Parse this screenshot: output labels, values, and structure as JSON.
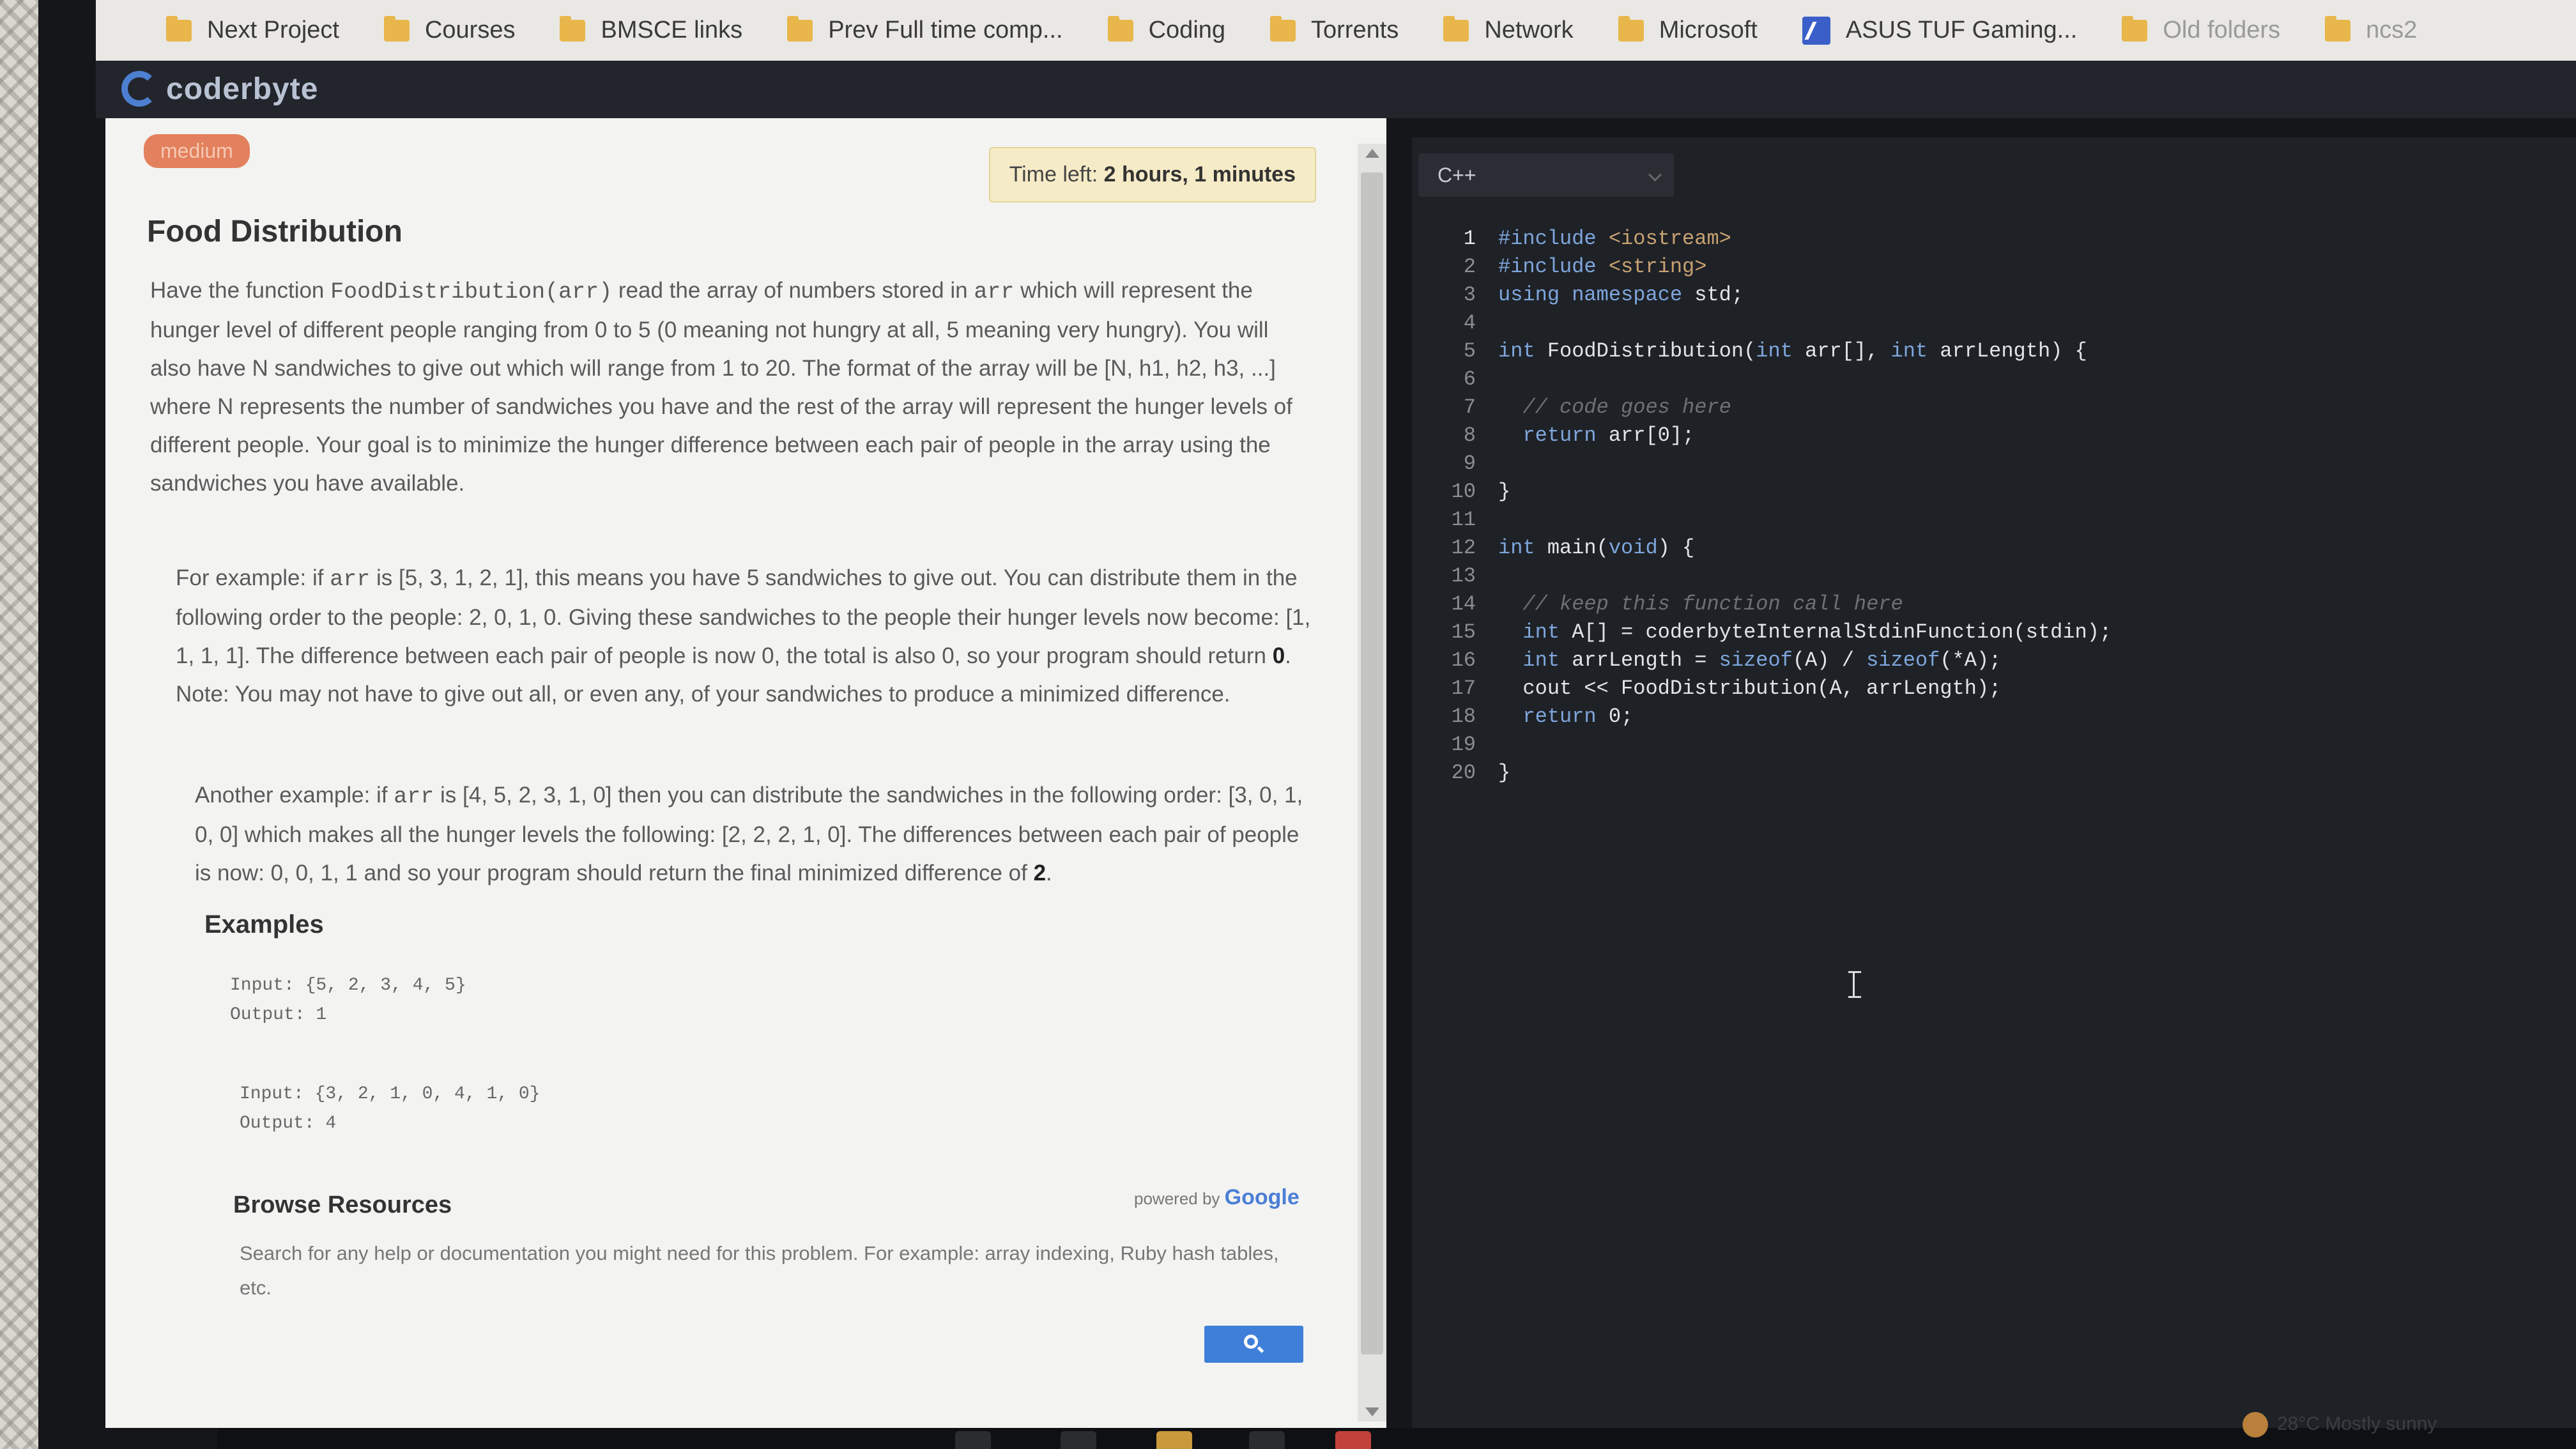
{
  "bookmarks": [
    {
      "label": "Next Project",
      "faded": false
    },
    {
      "label": "Courses",
      "faded": false
    },
    {
      "label": "BMSCE links",
      "faded": false
    },
    {
      "label": "Prev Full time comp...",
      "faded": false
    },
    {
      "label": "Coding",
      "faded": false
    },
    {
      "label": "Torrents",
      "faded": false
    },
    {
      "label": "Network",
      "faded": false
    },
    {
      "label": "Microsoft",
      "faded": false
    },
    {
      "label": "ASUS TUF Gaming...",
      "faded": false
    },
    {
      "label": "Old folders",
      "faded": true
    },
    {
      "label": "ncs2",
      "faded": true
    }
  ],
  "header": {
    "logo_text": "coderbyte"
  },
  "problem": {
    "difficulty": "medium",
    "timer_label": "Time left:",
    "timer_value": "2 hours, 1 minutes",
    "title": "Food Distribution",
    "p1_a": "Have the function ",
    "p1_code": "FoodDistribution(arr)",
    "p1_b": " read the array of numbers stored in ",
    "p1_code2": "arr",
    "p1_c": " which will represent the hunger level of different people ranging from 0 to 5 (0 meaning not hungry at all, 5 meaning very hungry). You will also have N sandwiches to give out which will range from 1 to 20. The format of the array will be [N, h1, h2, h3, ...] where N represents the number of sandwiches you have and the rest of the array will represent the hunger levels of different people. Your goal is to minimize the hunger difference between each pair of people in the array using the sandwiches you have available.",
    "p2_a": "For example: if ",
    "p2_code": "arr",
    "p2_b": " is [5, 3, 1, 2, 1], this means you have 5 sandwiches to give out. You can distribute them in the following order to the people: 2, 0, 1, 0. Giving these sandwiches to the people their hunger levels now become: [1, 1, 1, 1]. The difference between each pair of people is now 0, the total is also 0, so your program should return ",
    "p2_bold": "0",
    "p2_c": ". Note: You may not have to give out all, or even any, of your sandwiches to produce a minimized difference.",
    "p3_a": "Another example: if ",
    "p3_code": "arr",
    "p3_b": " is [4, 5, 2, 3, 1, 0] then you can distribute the sandwiches in the following order: [3, 0, 1, 0, 0] which makes all the hunger levels the following: [2, 2, 2, 1, 0]. The differences between each pair of people is now: 0, 0, 1, 1 and so your program should return the final minimized difference of ",
    "p3_bold": "2",
    "p3_c": ".",
    "examples_heading": "Examples",
    "examples": [
      {
        "input": "Input: {5, 2, 3, 4, 5}",
        "output": "Output: 1"
      },
      {
        "input": "Input: {3, 2, 1, 0, 4, 1, 0}",
        "output": "Output: 4"
      }
    ],
    "browse_heading": "Browse Resources",
    "powered_by": "powered by",
    "powered_brand": "Google",
    "resources_text": "Search for any help or documentation you might need for this problem. For example: array indexing, Ruby hash tables, etc."
  },
  "editor": {
    "language": "C++",
    "lines": [
      {
        "n": "1",
        "html": "<span class=\"kw\">#include</span> <span class=\"st\">&lt;iostream&gt;</span>",
        "indent": 0
      },
      {
        "n": "2",
        "html": "<span class=\"kw\">#include</span> <span class=\"st\">&lt;string&gt;</span>",
        "indent": 0
      },
      {
        "n": "3",
        "html": "<span class=\"kw\">using namespace</span> std;",
        "indent": 0
      },
      {
        "n": "4",
        "html": "",
        "indent": 0
      },
      {
        "n": "5",
        "html": "<span class=\"kw\">int</span> FoodDistribution(<span class=\"kw\">int</span> arr[], <span class=\"kw\">int</span> arrLength) {",
        "indent": 0
      },
      {
        "n": "6",
        "html": "",
        "indent": 0
      },
      {
        "n": "7",
        "html": "  <span class=\"cm\">// code goes here</span>",
        "indent": 0
      },
      {
        "n": "8",
        "html": "  <span class=\"kw\">return</span> arr[0];",
        "indent": 0
      },
      {
        "n": "9",
        "html": "",
        "indent": 0
      },
      {
        "n": "10",
        "html": "}",
        "indent": 0
      },
      {
        "n": "11",
        "html": "",
        "indent": 0
      },
      {
        "n": "12",
        "html": "<span class=\"kw\">int</span> main(<span class=\"kw\">void</span>) {",
        "indent": 0
      },
      {
        "n": "13",
        "html": "",
        "indent": 0
      },
      {
        "n": "14",
        "html": "  <span class=\"cm\">// keep this function call here</span>",
        "indent": 0
      },
      {
        "n": "15",
        "html": "  <span class=\"kw\">int</span> A[] = coderbyteInternalStdinFunction(stdin);",
        "indent": 0
      },
      {
        "n": "16",
        "html": "  <span class=\"kw\">int</span> arrLength = <span class=\"kw\">sizeof</span>(A) / <span class=\"kw\">sizeof</span>(*A);",
        "indent": 0
      },
      {
        "n": "17",
        "html": "  cout &lt;&lt; FoodDistribution(A, arrLength);",
        "indent": 0
      },
      {
        "n": "18",
        "html": "  <span class=\"kw\">return</span> 0;",
        "indent": 0
      },
      {
        "n": "19",
        "html": "",
        "indent": 0
      },
      {
        "n": "20",
        "html": "}",
        "indent": 0
      }
    ]
  },
  "taskbar": {
    "weather_text": "28°C  Mostly sunny"
  },
  "colors": {
    "accent_blue": "#3f7fd9",
    "badge_orange": "#e3805d",
    "folder_yellow": "#e8b64a"
  }
}
